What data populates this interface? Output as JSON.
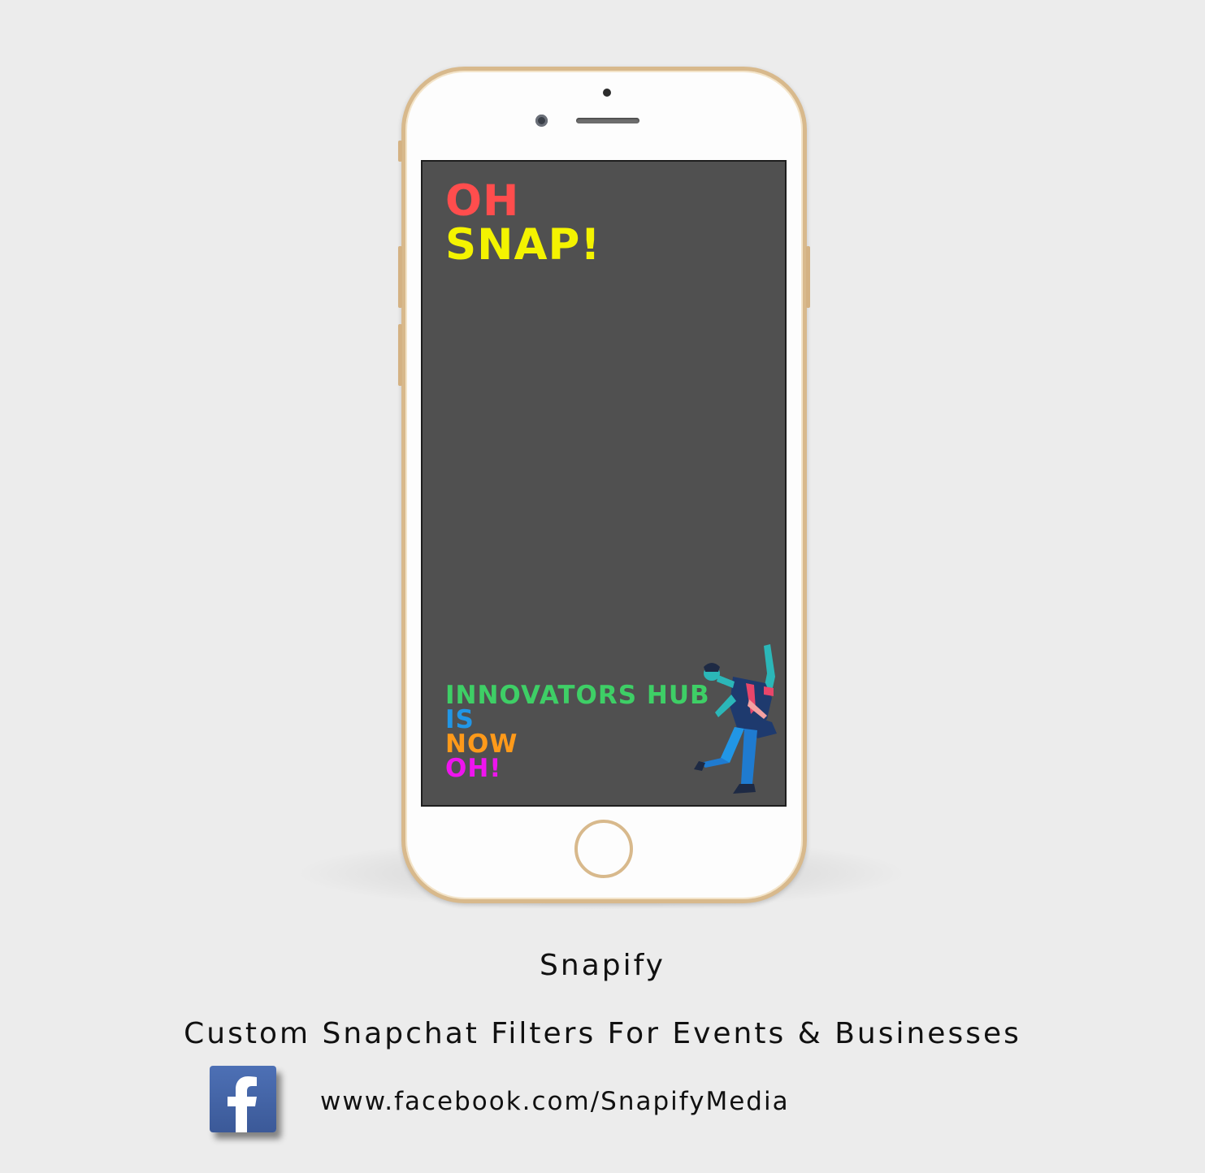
{
  "phone_screen": {
    "headline": {
      "line1": "OH",
      "line2": "SNAP!"
    },
    "tagline": {
      "line1": "INNOVATORS HUB",
      "line2": "IS",
      "line3": "NOW",
      "line4": "OH!"
    },
    "illustration": "dancing-man-icon"
  },
  "footer": {
    "brand": "Snapify",
    "subtitle": "Custom Snapchat Filters For Events & Businesses",
    "facebook_icon": "facebook-icon",
    "facebook_url": "www.facebook.com/SnapifyMedia"
  },
  "colors": {
    "background": "#ececec",
    "screen": "#505050",
    "phone_body": "#fdfdfd",
    "phone_frame": "#d8b98c",
    "oh_red": "#ff4d4d",
    "snap_yellow": "#f4f300",
    "innovators_green": "#3ecf66",
    "is_blue": "#2196e6",
    "now_orange": "#ff9a1a",
    "oh_magenta": "#ee14ee",
    "facebook_blue": "#3b5998"
  }
}
